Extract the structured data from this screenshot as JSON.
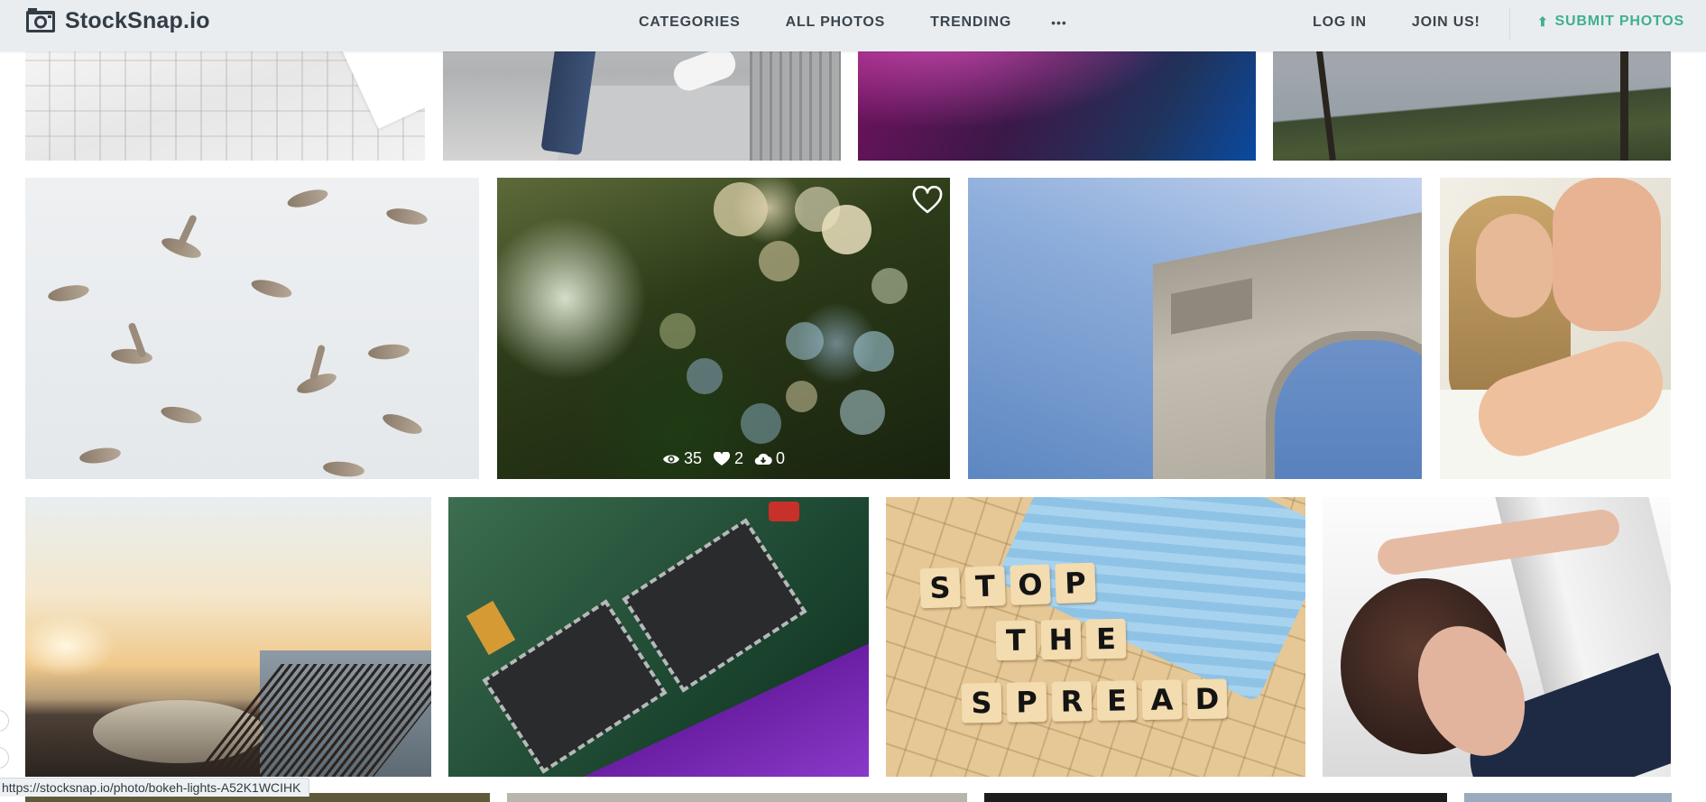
{
  "header": {
    "logo_text": "StockSnap.io",
    "nav": {
      "categories": "CATEGORIES",
      "all_photos": "ALL PHOTOS",
      "trending": "TRENDING",
      "more": "•••"
    },
    "auth": {
      "login": "LOG IN",
      "join": "JOIN US!"
    },
    "submit": {
      "label": "SUBMIT PHOTOS",
      "icon": "upload-icon",
      "color": "#3fb08f"
    }
  },
  "hovered_photo": {
    "favorite_icon": "heart-outline-icon",
    "views": "35",
    "likes": "2",
    "downloads": "0"
  },
  "scrabble_tiles": {
    "line1": [
      "S",
      "T",
      "O",
      "P"
    ],
    "line2": [
      "T",
      "H",
      "E"
    ],
    "line3": [
      "S",
      "P",
      "R",
      "E",
      "A",
      "D"
    ]
  },
  "status_bar": {
    "url": "https://stocksnap.io/photo/bokeh-lights-A52K1WCIHK"
  },
  "colors": {
    "header_bg": "#e9edf0",
    "nav_text": "#3b444b",
    "accent": "#3fb08f"
  }
}
